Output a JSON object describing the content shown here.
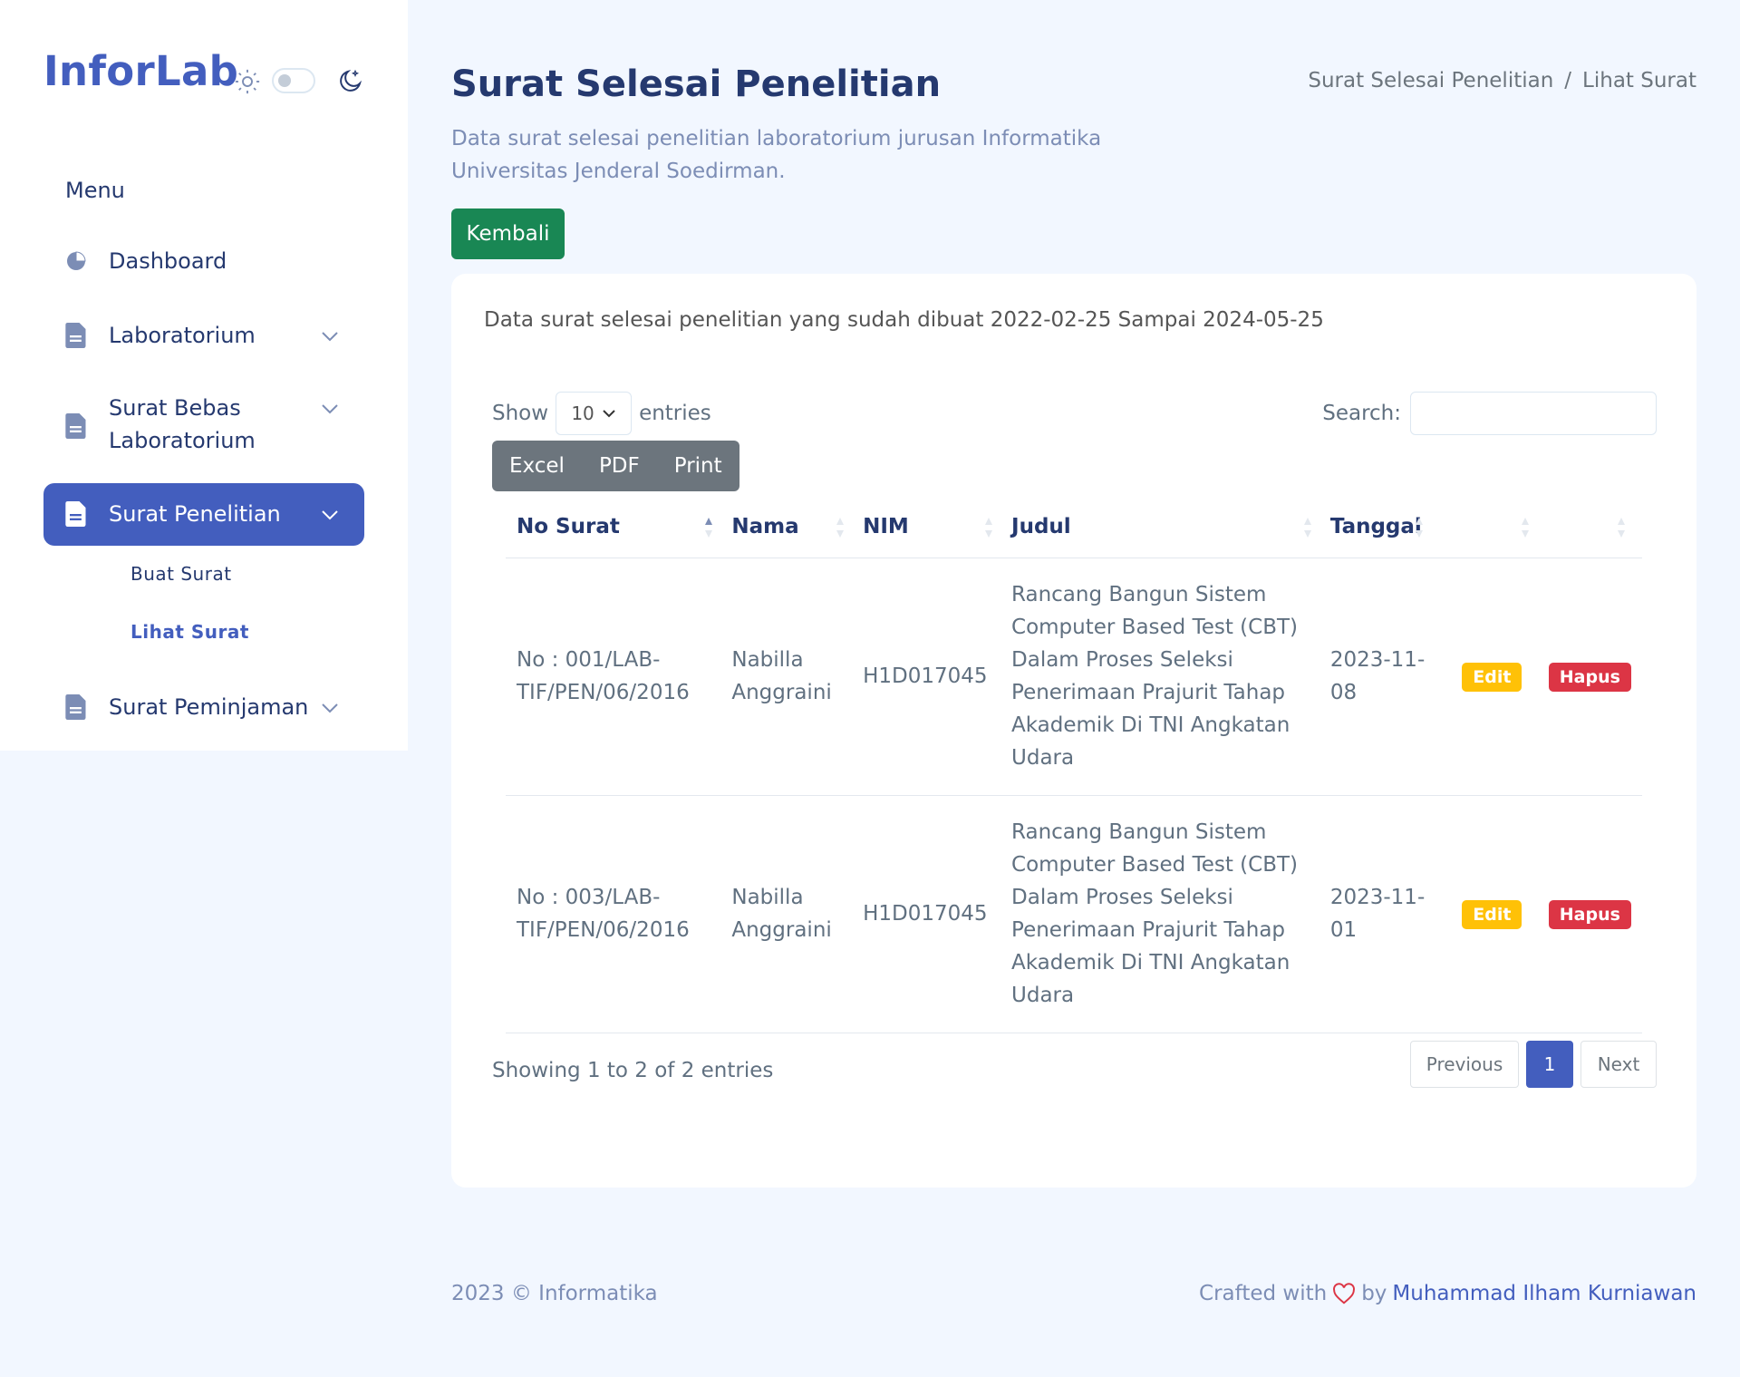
{
  "brand": "InforLab",
  "sidebar": {
    "menu_title": "Menu",
    "items": [
      {
        "label": "Dashboard",
        "icon": "pie-chart-icon"
      },
      {
        "label": "Laboratorium",
        "icon": "file-icon"
      },
      {
        "label_line1": "Surat Bebas",
        "label_line2": "Laboratorium",
        "icon": "file-icon"
      },
      {
        "label": "Surat Penelitian",
        "icon": "file-icon",
        "active": true
      },
      {
        "label": "Surat Peminjaman",
        "icon": "file-icon"
      }
    ],
    "sub_items": [
      {
        "label": "Buat Surat"
      },
      {
        "label": "Lihat Surat",
        "current": true
      }
    ]
  },
  "header": {
    "title": "Surat Selesai Penelitian",
    "subtitle": "Data surat selesai penelitian laboratorium jurusan Informatika Universitas Jenderal Soedirman.",
    "breadcrumb": {
      "parent": "Surat Selesai Penelitian",
      "separator": "/",
      "current": "Lihat Surat"
    },
    "back_button": "Kembali"
  },
  "card": {
    "info": "Data surat selesai penelitian yang sudah dibuat 2022-02-25 Sampai 2024-05-25",
    "show_label": "Show",
    "show_value": "10",
    "entries_label": "entries",
    "search_label": "Search:",
    "search_value": "",
    "export_buttons": [
      "Excel",
      "PDF",
      "Print"
    ],
    "columns": [
      "No Surat",
      "Nama",
      "NIM",
      "Judul",
      "Tanggal",
      "",
      ""
    ],
    "rows": [
      {
        "no_surat": "No : 001/LAB-TIF/PEN/06/2016",
        "nama": "Nabilla Anggraini",
        "nim": "H1D017045",
        "judul": "Rancang Bangun Sistem Computer Based Test (CBT) Dalam Proses Seleksi Penerimaan Prajurit Tahap Akademik Di TNI Angkatan Udara",
        "tanggal": "2023-11-08",
        "edit": "Edit",
        "hapus": "Hapus"
      },
      {
        "no_surat": "No : 003/LAB-TIF/PEN/06/2016",
        "nama": "Nabilla Anggraini",
        "nim": "H1D017045",
        "judul": "Rancang Bangun Sistem Computer Based Test (CBT) Dalam Proses Seleksi Penerimaan Prajurit Tahap Akademik Di TNI Angkatan Udara",
        "tanggal": "2023-11-01",
        "edit": "Edit",
        "hapus": "Hapus"
      }
    ],
    "showing": "Showing 1 to 2 of 2 entries",
    "pager": {
      "previous": "Previous",
      "page": "1",
      "next": "Next"
    }
  },
  "footer": {
    "left": "2023 © Informatika",
    "crafted": "Crafted with",
    "by": "by",
    "author": "Muhammad Ilham Kurniawan"
  },
  "colors": {
    "primary": "#435ebe",
    "success": "#198754",
    "warning": "#ffc107",
    "danger": "#dc3545",
    "background": "#f2f7ff"
  }
}
